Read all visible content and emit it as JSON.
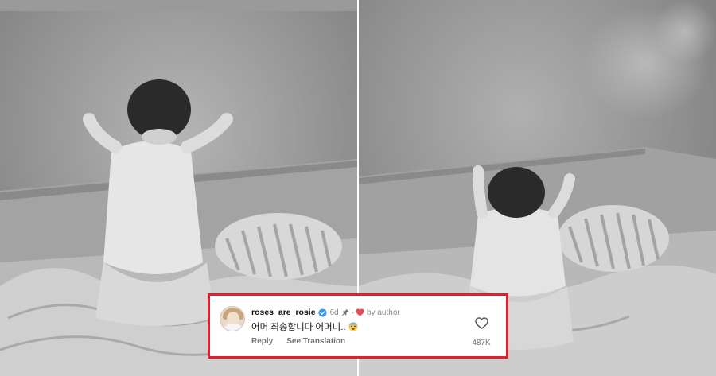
{
  "photos": {
    "left": {
      "subject": "child-at-wall"
    },
    "right": {
      "subject": "child-at-wall-facing-away"
    }
  },
  "comment": {
    "username": "roses_are_rosie",
    "time": "6d",
    "separator": "·",
    "author_badge": "by author",
    "text": "어머 죄송합니다 어머니..",
    "emoji": "fearful-face",
    "reply_label": "Reply",
    "translate_label": "See Translation",
    "like_count": "487K",
    "colors": {
      "highlight_border": "#e0202a",
      "verified": "#3897f0",
      "heart": "#ed4956"
    }
  }
}
